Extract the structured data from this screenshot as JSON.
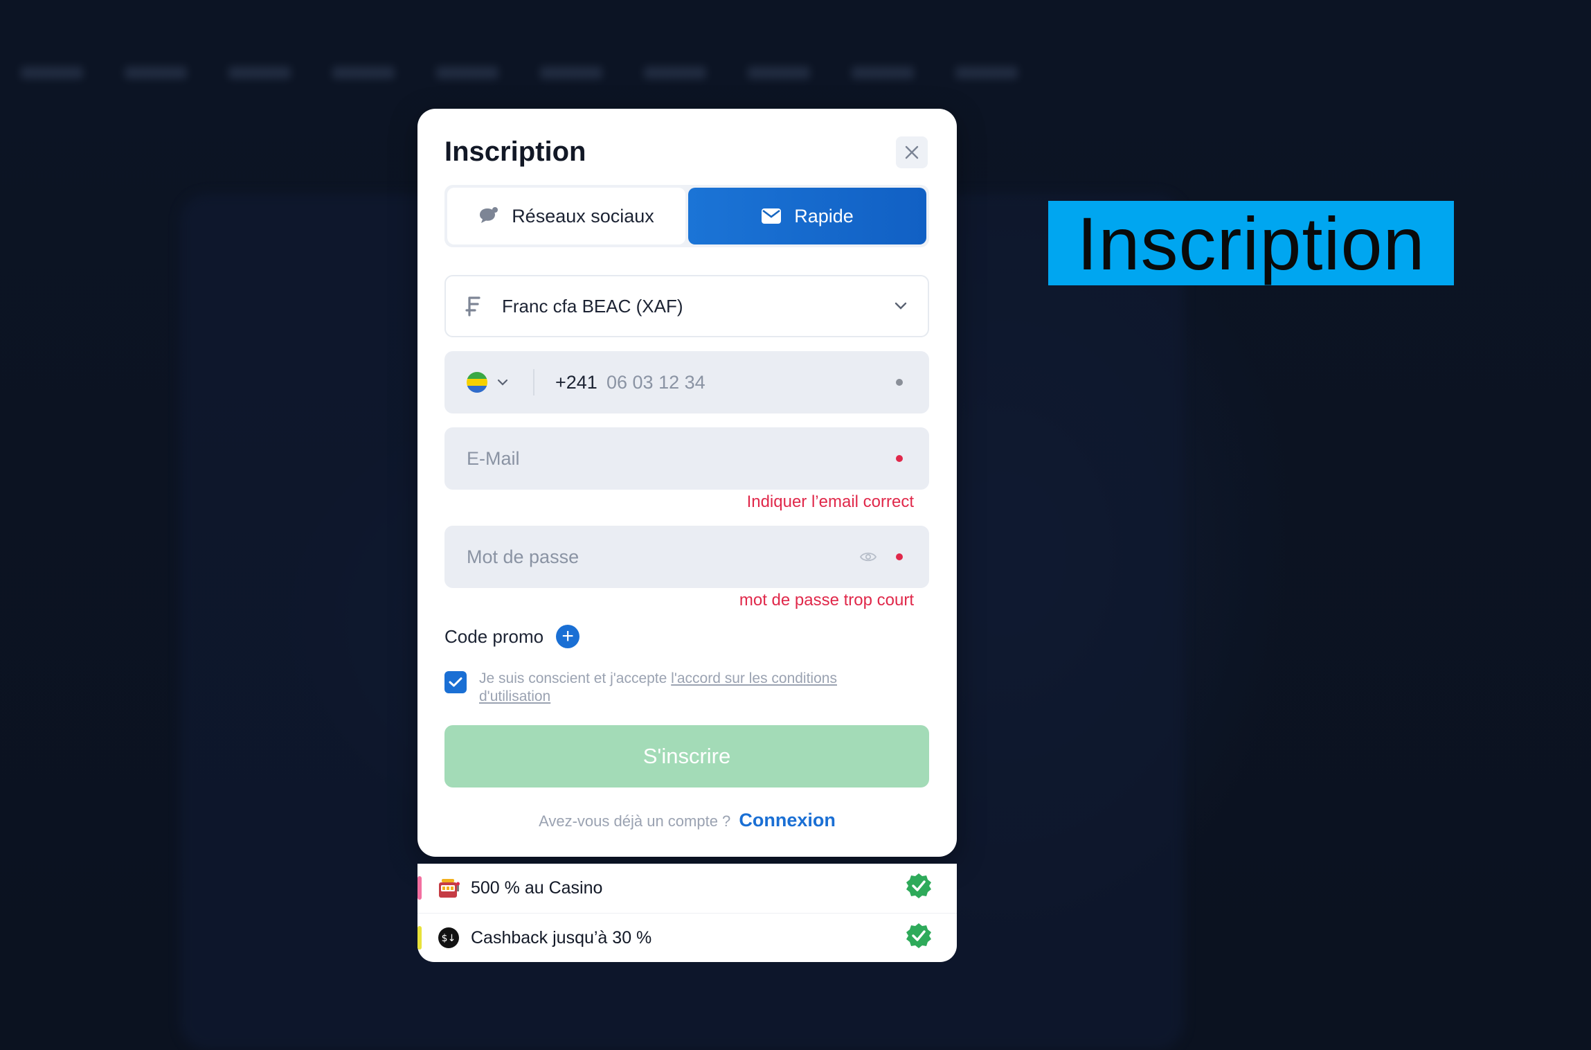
{
  "modal": {
    "title": "Inscription",
    "tabs": [
      {
        "label": "Réseaux sociaux",
        "icon": "chat-bubble-icon",
        "active": false
      },
      {
        "label": "Rapide",
        "icon": "envelope-icon",
        "active": true
      }
    ],
    "currency": {
      "value": "Franc cfa BEAC (XAF)",
      "icon": "franc-icon"
    },
    "phone": {
      "country_code": "+241",
      "placeholder": "06 03 12 34",
      "flag": "gabon-flag"
    },
    "email": {
      "placeholder": "E-Mail",
      "error": "Indiquer l’email correct"
    },
    "password": {
      "placeholder": "Mot de passe",
      "error": "mot de passe trop court"
    },
    "promo": {
      "label": "Code promo"
    },
    "terms": {
      "text": "Je suis conscient et j'accepte",
      "link": "l'accord sur les conditions d'utilisation",
      "checked": true
    },
    "submit_label": "S'inscrire",
    "login": {
      "prompt": "Avez-vous déjà un compte ?",
      "link": "Connexion"
    }
  },
  "bonuses": [
    {
      "label": "500 % au Casino",
      "icon": "slot-machine-icon"
    },
    {
      "label": "Cashback jusqu’à 30 %",
      "icon": "cashback-icon"
    }
  ],
  "overlay_label": "Inscription",
  "colors": {
    "accent": "#1a6fd4",
    "error": "#e0284a",
    "submit_disabled": "#a3dbb7",
    "overlay_label_bg": "#00a6f0",
    "check_green": "#2eaa5a"
  }
}
